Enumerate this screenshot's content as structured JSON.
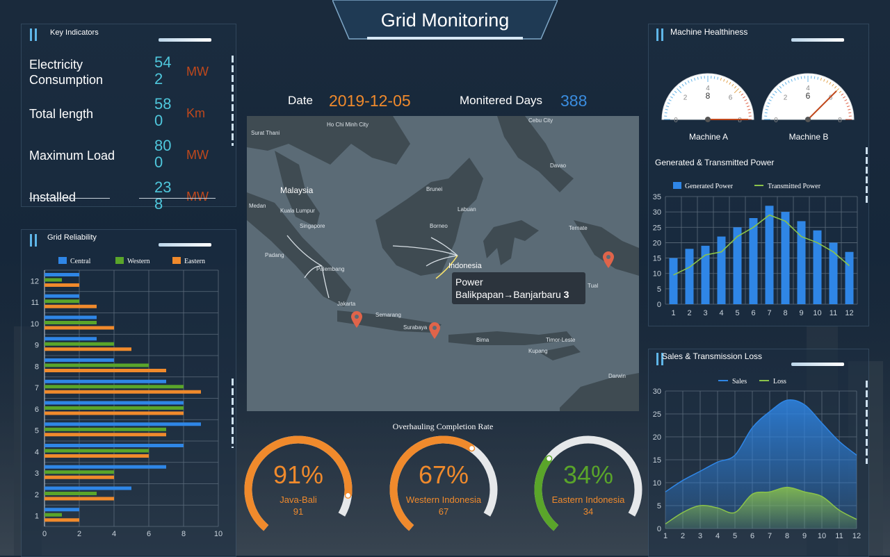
{
  "header": {
    "title": "Grid Monitoring"
  },
  "key_indicators": {
    "title": "Key Indicators",
    "items": [
      {
        "label": "Electricity Consumption",
        "value": "542",
        "unit": "MW"
      },
      {
        "label": "Total length",
        "value": "580",
        "unit": "Km"
      },
      {
        "label": "Maximum Load",
        "value": "800",
        "unit": "MW"
      },
      {
        "label": "Installed",
        "value": "238",
        "unit": "MW"
      }
    ]
  },
  "date_row": {
    "date_label": "Date",
    "date_value": "2019-12-05",
    "days_label": "Monitered Days",
    "days_value": "388"
  },
  "map": {
    "labels": [
      "Surat Thani",
      "Ho Chi Minh City",
      "Cebu City",
      "Malaysia",
      "Brunei",
      "Davao",
      "Medan",
      "Kuala Lumpur",
      "Labuan",
      "Singapore",
      "Borneo",
      "Ternate",
      "Padang",
      "Indonesia",
      "Palembang",
      "Jakarta",
      "Semarang",
      "Surabaya",
      "Bima",
      "Timor-Leste",
      "Kupang",
      "Darwin",
      "Tual"
    ],
    "tooltip": {
      "line1": "Power",
      "line2": "Balikpapan→Banjarbaru",
      "value": "3"
    }
  },
  "overhaul": {
    "title": "Overhauling Completion Rate",
    "gauges": [
      {
        "percent_label": "91%",
        "name": "Java-Bali",
        "value": 91,
        "value_label": "91",
        "color": "#f08a2c"
      },
      {
        "percent_label": "67%",
        "name": "Western Indonesia",
        "value": 67,
        "value_label": "67",
        "color": "#f08a2c"
      },
      {
        "percent_label": "34%",
        "name": "Eastern Indonesia",
        "value": 34,
        "value_label": "34",
        "color": "#5aa52a"
      }
    ]
  },
  "machine_health": {
    "title": "Machine Healthiness",
    "machines": [
      {
        "name": "Machine A",
        "value": 8,
        "ticks": [
          "0",
          "2",
          "4",
          "6",
          "8"
        ]
      },
      {
        "name": "Machine B",
        "value": 6,
        "ticks": [
          "0",
          "2",
          "4",
          "6",
          "8"
        ]
      }
    ]
  },
  "grid_reliability": {
    "title": "Grid Reliability"
  },
  "gen_trans": {
    "title": "Generated & Transmitted Power"
  },
  "sales_loss": {
    "title": "Sales & Transmission Loss"
  },
  "colors": {
    "accent_orange": "#f08a2c",
    "accent_blue": "#2f86e6",
    "accent_green": "#5aa52a",
    "cyan_value": "#4fc7dc"
  },
  "chart_data": [
    {
      "type": "bar",
      "orientation": "horizontal",
      "categories": [
        "1",
        "2",
        "3",
        "4",
        "5",
        "6",
        "7",
        "8",
        "9",
        "10",
        "11",
        "12"
      ],
      "series": [
        {
          "name": "Central",
          "color": "#2f86e6",
          "values": [
            2,
            5,
            7,
            8,
            9,
            8,
            7,
            4,
            3,
            3,
            2,
            2
          ]
        },
        {
          "name": "Western",
          "color": "#5aa52a",
          "values": [
            1,
            3,
            4,
            6,
            7,
            8,
            8,
            6,
            4,
            3,
            2,
            1
          ]
        },
        {
          "name": "Eastern",
          "color": "#f08a2c",
          "values": [
            2,
            4,
            4,
            6,
            7,
            8,
            9,
            7,
            5,
            4,
            3,
            2
          ]
        }
      ],
      "xlim": [
        0,
        10
      ],
      "xticks": [
        "0",
        "2",
        "4",
        "6",
        "8",
        "10"
      ],
      "grid": true,
      "legend": "top"
    },
    {
      "type": "bar",
      "categories": [
        "1",
        "2",
        "3",
        "4",
        "5",
        "6",
        "7",
        "8",
        "9",
        "10",
        "11",
        "12"
      ],
      "series": [
        {
          "name": "Generated Power",
          "type": "bar",
          "color": "#2f86e6",
          "values": [
            15,
            18,
            19,
            22,
            25,
            28,
            32,
            30,
            27,
            24,
            20,
            17
          ]
        },
        {
          "name": "Transmitted Power",
          "type": "line",
          "color": "#8bc34a",
          "values": [
            9.5,
            12,
            16,
            17,
            22,
            25,
            29,
            27,
            22,
            20,
            17,
            12.5
          ]
        }
      ],
      "ylim": [
        0,
        35
      ],
      "yticks": [
        "0",
        "5",
        "10",
        "15",
        "20",
        "25",
        "30",
        "35"
      ],
      "grid": true,
      "legend": "top"
    },
    {
      "type": "area",
      "x": [
        "1",
        "2",
        "3",
        "4",
        "5",
        "6",
        "7",
        "8",
        "9",
        "10",
        "11",
        "12"
      ],
      "series": [
        {
          "name": "Sales",
          "color": "#2f86e6",
          "values": [
            8,
            10.5,
            12.5,
            14.5,
            16,
            22,
            25.5,
            28,
            27,
            23,
            19,
            16
          ]
        },
        {
          "name": "Loss",
          "color": "#8bc34a",
          "values": [
            1,
            3.5,
            5,
            4.5,
            3.5,
            7.5,
            8,
            9,
            8,
            7,
            4,
            2
          ]
        }
      ],
      "ylim": [
        0,
        30
      ],
      "yticks": [
        "0",
        "5",
        "10",
        "15",
        "20",
        "25",
        "30"
      ],
      "grid": true,
      "legend": "top"
    }
  ]
}
